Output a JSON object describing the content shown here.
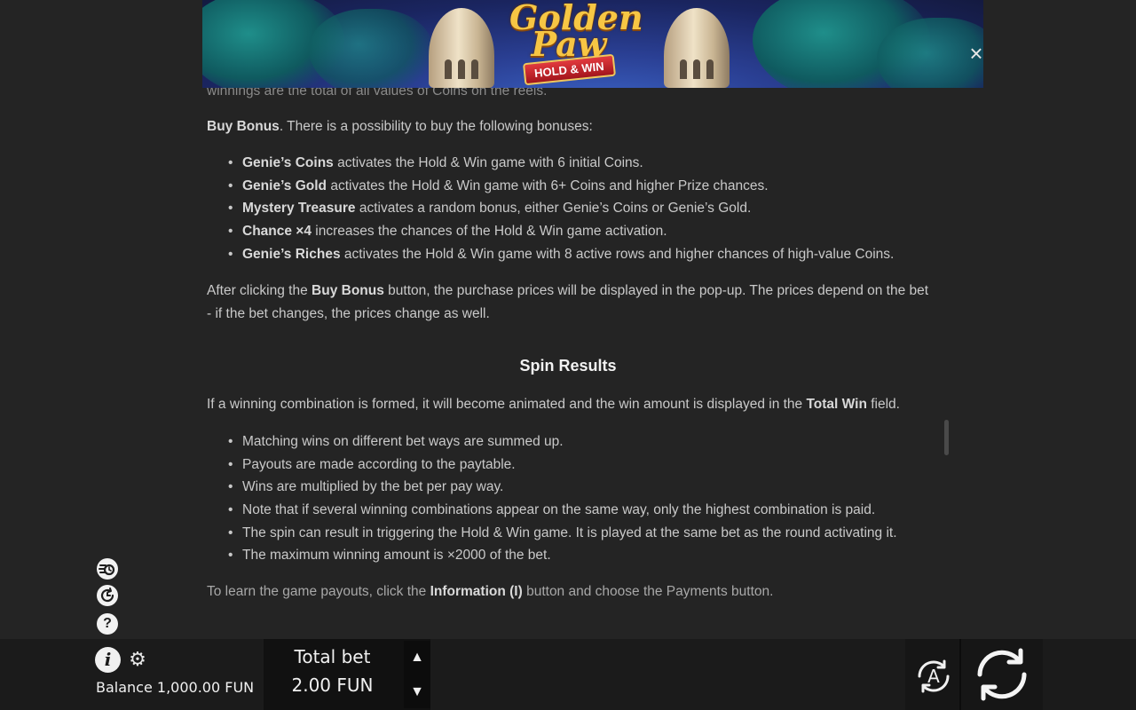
{
  "banner": {
    "logo_word_1": "Golden",
    "logo_word_2": "Paw",
    "logo_ribbon": "HOLD & WIN"
  },
  "close_label": "×",
  "content": {
    "cut_line": "winnings are the total of all values of Coins on the reels.",
    "buy_bonus_title": "Buy Bonus",
    "buy_bonus_intro": ". There is a possibility to buy the following bonuses:",
    "bonuses": [
      {
        "name": "Genie’s Coins",
        "desc": " activates the Hold & Win game with 6 initial Coins."
      },
      {
        "name": "Genie’s Gold",
        "desc": " activates the Hold & Win game with 6+ Coins and higher Prize chances."
      },
      {
        "name": "Mystery Treasure",
        "desc": " activates a random bonus, either Genie’s Coins or Genie’s Gold."
      },
      {
        "name": "Chance ×4",
        "desc": " increases the chances of the Hold & Win game activation."
      },
      {
        "name": "Genie’s Riches",
        "desc": " activates the Hold & Win game with 8 active rows and higher chances of high-value Coins."
      }
    ],
    "after_click_1": "After clicking the ",
    "after_click_bold": "Buy Bonus",
    "after_click_2": " button, the purchase prices will be displayed in the pop-up. The prices depend on the bet - if the bet changes, the prices change as well.",
    "spin_results_heading": "Spin Results",
    "winning_1": "If a winning combination is formed, it will become animated and the win amount is displayed in the ",
    "winning_bold": "Total Win",
    "winning_2": " field.",
    "spin_points": [
      "Matching wins on different bet ways are summed up.",
      "Payouts are made according to the paytable.",
      "Wins are multiplied by the bet per pay way.",
      "Note that if several winning combinations appear on the same way, only the highest combination is paid.",
      "The spin can result in triggering the Hold & Win game. It is played at the same bet as the round activating it.",
      "The maximum winning amount is ×2000 of the bet."
    ],
    "learn_1": "To learn the game payouts, click the ",
    "learn_bold": "Information (I)",
    "learn_2": " button and choose the Payments button."
  },
  "side_icons": {
    "turbo": "turbo-icon",
    "history": "history-icon",
    "help": "?"
  },
  "bottom": {
    "info_label": "i",
    "balance": "Balance 1,000.00 FUN",
    "bet_label": "Total bet",
    "bet_value": "2.00 FUN",
    "auto_label": "A"
  }
}
